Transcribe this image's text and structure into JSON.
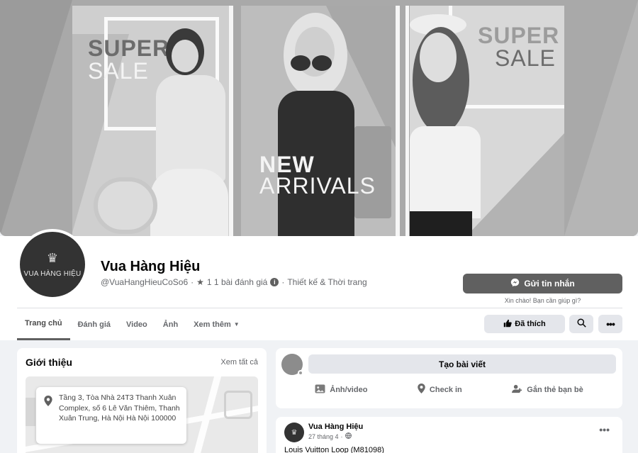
{
  "cover": {
    "panel1_text_line1": "SUPER",
    "panel1_text_line2": "SALE",
    "panel2_text_line1": "NEW",
    "panel2_text_line2": "ARRIVALS",
    "panel3_text_line1": "SUPER",
    "panel3_text_line2": "SALE"
  },
  "profile": {
    "avatar_logo": "VUA HÀNG HIỆU",
    "page_name": "Vua Hàng Hiệu",
    "username": "@VuaHangHieuCoSo6",
    "separator": "·",
    "rating": "1 1 bài đánh giá",
    "category": "Thiết kế & Thời trang",
    "message_button": "Gửi tin nhắn",
    "message_hint": "Xin chào! Bạn cần giúp gì?"
  },
  "tabs": [
    {
      "label": "Trang chủ",
      "active": true
    },
    {
      "label": "Đánh giá"
    },
    {
      "label": "Video"
    },
    {
      "label": "Ảnh"
    },
    {
      "label": "Xem thêm"
    }
  ],
  "actions": {
    "like_button": "Đã thích",
    "search_icon": "search-icon",
    "more_icon": "more-icon"
  },
  "intro": {
    "title": "Giới thiệu",
    "see_all": "Xem tất cả",
    "address": "Tầng 3, Tòa Nhà 24T3 Thanh Xuân Complex, số 6 Lê Văn Thiêm, Thanh Xuân Trung, Hà Nội Hà Nội 100000"
  },
  "create_post": {
    "button": "Tạo bài viết",
    "options": [
      {
        "label": "Ảnh/video",
        "icon": "photo-icon"
      },
      {
        "label": "Check in",
        "icon": "location-pin-icon"
      },
      {
        "label": "Gắn thẻ bạn bè",
        "icon": "tag-friends-icon"
      }
    ]
  },
  "post": {
    "author": "Vua Hàng Hiệu",
    "date": "27 tháng 4",
    "separator": "·",
    "text": "Louis Vuitton Loop (M81098)"
  }
}
